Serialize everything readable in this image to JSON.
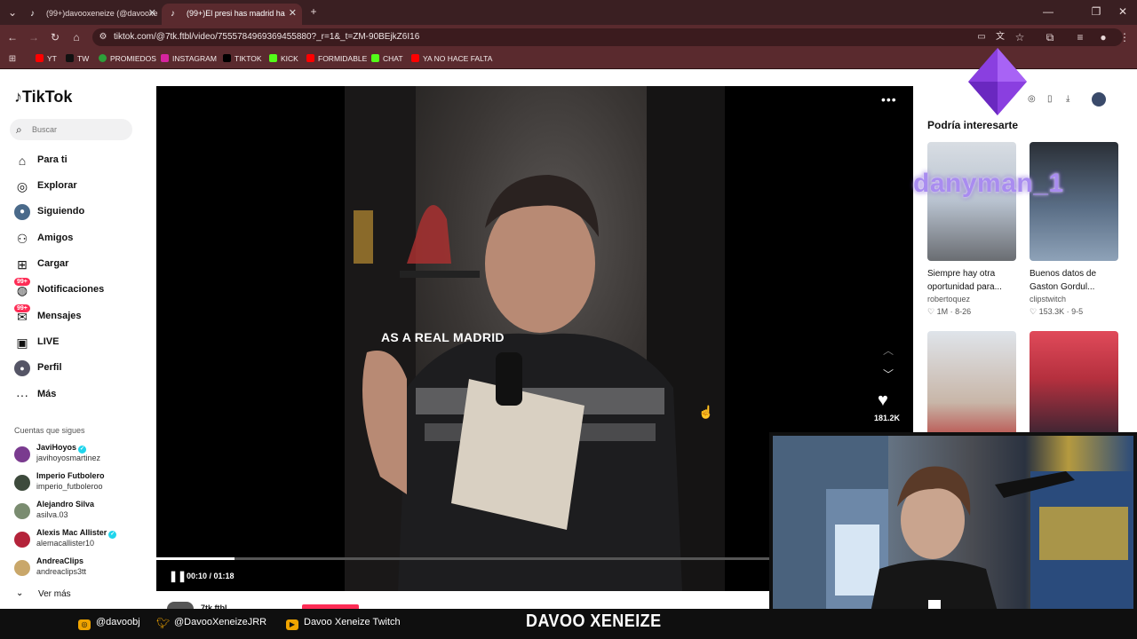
{
  "browser": {
    "tabs": [
      {
        "title": "(99+)davooxeneize (@davooxe",
        "active": false
      },
      {
        "title": "(99+)El presi has madrid ha",
        "active": true
      }
    ],
    "url": "tiktok.com/@7tk.ftbl/video/7555784969369455880?_r=1&_t=ZM-90BEjkZ6I16",
    "bookmarks": [
      "YT",
      "TW",
      "PROMIEDOS",
      "INSTAGRAM",
      "TIKTOK",
      "KICK",
      "FORMIDABLE",
      "CHAT",
      "YA NO HACE FALTA"
    ]
  },
  "sidebar": {
    "logo": "TikTok",
    "search_placeholder": "Buscar",
    "nav": [
      {
        "label": "Para ti",
        "icon": "home-icon",
        "badge": ""
      },
      {
        "label": "Explorar",
        "icon": "compass-icon",
        "badge": ""
      },
      {
        "label": "Siguiendo",
        "icon": "following-avatar-icon",
        "badge": ""
      },
      {
        "label": "Amigos",
        "icon": "friends-icon",
        "badge": ""
      },
      {
        "label": "Cargar",
        "icon": "upload-icon",
        "badge": ""
      },
      {
        "label": "Notificaciones",
        "icon": "bell-icon",
        "badge": "99+"
      },
      {
        "label": "Mensajes",
        "icon": "message-icon",
        "badge": "99+"
      },
      {
        "label": "LIVE",
        "icon": "live-icon",
        "badge": ""
      },
      {
        "label": "Perfil",
        "icon": "profile-icon",
        "badge": ""
      },
      {
        "label": "Más",
        "icon": "more-dots-icon",
        "badge": ""
      }
    ],
    "following_title": "Cuentas que sigues",
    "following": [
      {
        "name": "JaviHoyos",
        "handle": "javihoyosmartinez",
        "verified": true
      },
      {
        "name": "Imperio Futbolero",
        "handle": "imperio_futboleroo",
        "verified": false
      },
      {
        "name": "Alejandro Silva",
        "handle": "asilva.03",
        "verified": false
      },
      {
        "name": "Alexis Mac Allister",
        "handle": "alemacallister10",
        "verified": true
      },
      {
        "name": "AndreaClips",
        "handle": "andreaclips3tt",
        "verified": false
      }
    ],
    "ver_mas": "Ver más"
  },
  "video": {
    "caption": "AS A REAL MADRID",
    "time": "00:10 / 01:18",
    "progress": 0.128,
    "likes": "181.2K",
    "author_partial": "7tk.ftbl"
  },
  "recommendations": {
    "title": "Podría interesarte",
    "cards": [
      {
        "caption": "Siempre hay otra oportunidad para...",
        "user": "robertoquez",
        "likes": "1M",
        "date": "8-26"
      },
      {
        "caption": "Buenos datos de Gaston Gordul...",
        "user": "clipstwitch",
        "likes": "153.3K",
        "date": "9-5"
      },
      {
        "caption": "",
        "user": "",
        "likes": "",
        "date": ""
      },
      {
        "caption": "",
        "user": "",
        "likes": "",
        "date": ""
      }
    ]
  },
  "overlay": {
    "username": "danyman_1",
    "socials": [
      {
        "label": "@davoobj",
        "icon": "instagram-icon"
      },
      {
        "label": "@DavooXeneizeJRR",
        "icon": "twitter-icon"
      },
      {
        "label": "Davoo Xeneize Twitch",
        "icon": "youtube-icon"
      }
    ],
    "streamer_name": "DAVOO XENEIZE"
  },
  "colors": {
    "accent": "#fe2c55",
    "browser": "#5a2a2e"
  }
}
